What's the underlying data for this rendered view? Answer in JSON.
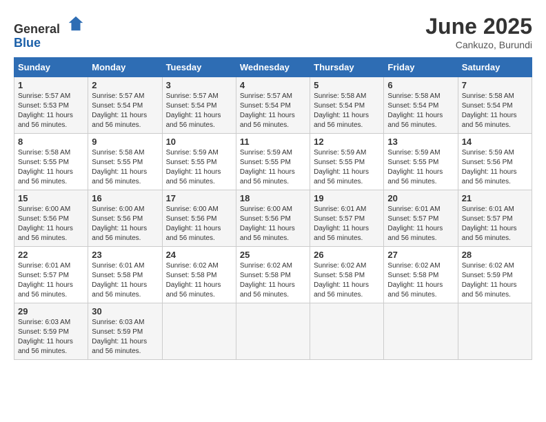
{
  "logo": {
    "general": "General",
    "blue": "Blue"
  },
  "title": {
    "month": "June 2025",
    "location": "Cankuzo, Burundi"
  },
  "weekdays": [
    "Sunday",
    "Monday",
    "Tuesday",
    "Wednesday",
    "Thursday",
    "Friday",
    "Saturday"
  ],
  "weeks": [
    [
      {
        "day": "1",
        "sunrise": "5:57 AM",
        "sunset": "5:53 PM",
        "daylight": "11 hours and 56 minutes."
      },
      {
        "day": "2",
        "sunrise": "5:57 AM",
        "sunset": "5:54 PM",
        "daylight": "11 hours and 56 minutes."
      },
      {
        "day": "3",
        "sunrise": "5:57 AM",
        "sunset": "5:54 PM",
        "daylight": "11 hours and 56 minutes."
      },
      {
        "day": "4",
        "sunrise": "5:57 AM",
        "sunset": "5:54 PM",
        "daylight": "11 hours and 56 minutes."
      },
      {
        "day": "5",
        "sunrise": "5:58 AM",
        "sunset": "5:54 PM",
        "daylight": "11 hours and 56 minutes."
      },
      {
        "day": "6",
        "sunrise": "5:58 AM",
        "sunset": "5:54 PM",
        "daylight": "11 hours and 56 minutes."
      },
      {
        "day": "7",
        "sunrise": "5:58 AM",
        "sunset": "5:54 PM",
        "daylight": "11 hours and 56 minutes."
      }
    ],
    [
      {
        "day": "8",
        "sunrise": "5:58 AM",
        "sunset": "5:55 PM",
        "daylight": "11 hours and 56 minutes."
      },
      {
        "day": "9",
        "sunrise": "5:58 AM",
        "sunset": "5:55 PM",
        "daylight": "11 hours and 56 minutes."
      },
      {
        "day": "10",
        "sunrise": "5:59 AM",
        "sunset": "5:55 PM",
        "daylight": "11 hours and 56 minutes."
      },
      {
        "day": "11",
        "sunrise": "5:59 AM",
        "sunset": "5:55 PM",
        "daylight": "11 hours and 56 minutes."
      },
      {
        "day": "12",
        "sunrise": "5:59 AM",
        "sunset": "5:55 PM",
        "daylight": "11 hours and 56 minutes."
      },
      {
        "day": "13",
        "sunrise": "5:59 AM",
        "sunset": "5:55 PM",
        "daylight": "11 hours and 56 minutes."
      },
      {
        "day": "14",
        "sunrise": "5:59 AM",
        "sunset": "5:56 PM",
        "daylight": "11 hours and 56 minutes."
      }
    ],
    [
      {
        "day": "15",
        "sunrise": "6:00 AM",
        "sunset": "5:56 PM",
        "daylight": "11 hours and 56 minutes."
      },
      {
        "day": "16",
        "sunrise": "6:00 AM",
        "sunset": "5:56 PM",
        "daylight": "11 hours and 56 minutes."
      },
      {
        "day": "17",
        "sunrise": "6:00 AM",
        "sunset": "5:56 PM",
        "daylight": "11 hours and 56 minutes."
      },
      {
        "day": "18",
        "sunrise": "6:00 AM",
        "sunset": "5:56 PM",
        "daylight": "11 hours and 56 minutes."
      },
      {
        "day": "19",
        "sunrise": "6:01 AM",
        "sunset": "5:57 PM",
        "daylight": "11 hours and 56 minutes."
      },
      {
        "day": "20",
        "sunrise": "6:01 AM",
        "sunset": "5:57 PM",
        "daylight": "11 hours and 56 minutes."
      },
      {
        "day": "21",
        "sunrise": "6:01 AM",
        "sunset": "5:57 PM",
        "daylight": "11 hours and 56 minutes."
      }
    ],
    [
      {
        "day": "22",
        "sunrise": "6:01 AM",
        "sunset": "5:57 PM",
        "daylight": "11 hours and 56 minutes."
      },
      {
        "day": "23",
        "sunrise": "6:01 AM",
        "sunset": "5:58 PM",
        "daylight": "11 hours and 56 minutes."
      },
      {
        "day": "24",
        "sunrise": "6:02 AM",
        "sunset": "5:58 PM",
        "daylight": "11 hours and 56 minutes."
      },
      {
        "day": "25",
        "sunrise": "6:02 AM",
        "sunset": "5:58 PM",
        "daylight": "11 hours and 56 minutes."
      },
      {
        "day": "26",
        "sunrise": "6:02 AM",
        "sunset": "5:58 PM",
        "daylight": "11 hours and 56 minutes."
      },
      {
        "day": "27",
        "sunrise": "6:02 AM",
        "sunset": "5:58 PM",
        "daylight": "11 hours and 56 minutes."
      },
      {
        "day": "28",
        "sunrise": "6:02 AM",
        "sunset": "5:59 PM",
        "daylight": "11 hours and 56 minutes."
      }
    ],
    [
      {
        "day": "29",
        "sunrise": "6:03 AM",
        "sunset": "5:59 PM",
        "daylight": "11 hours and 56 minutes."
      },
      {
        "day": "30",
        "sunrise": "6:03 AM",
        "sunset": "5:59 PM",
        "daylight": "11 hours and 56 minutes."
      },
      null,
      null,
      null,
      null,
      null
    ]
  ],
  "labels": {
    "sunrise": "Sunrise:",
    "sunset": "Sunset:",
    "daylight": "Daylight:"
  }
}
